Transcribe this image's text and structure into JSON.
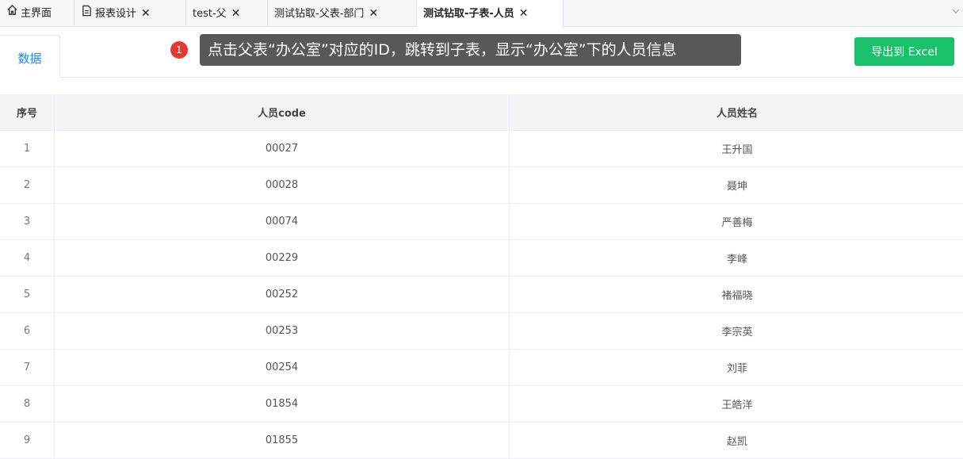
{
  "tabs": [
    {
      "label": "主界面",
      "closable": false,
      "icon": "home-icon"
    },
    {
      "label": "报表设计",
      "closable": true,
      "icon": "document-icon"
    },
    {
      "label": "test-父",
      "closable": true
    },
    {
      "label": "测试钻取-父表-部门",
      "closable": true
    },
    {
      "label": "测试钻取-子表-人员",
      "closable": true,
      "active": true
    }
  ],
  "close_glyph": "✕",
  "subtab": {
    "label": "数据"
  },
  "annotation": {
    "number": "1",
    "text": "点击父表“办公室”对应的ID，跳转到子表，显示“办公室”下的人员信息"
  },
  "toolbar": {
    "export_label": "导出到 Excel"
  },
  "table": {
    "headers": [
      "序号",
      "人员code",
      "人员姓名"
    ],
    "rows": [
      [
        "1",
        "00027",
        "王升国"
      ],
      [
        "2",
        "00028",
        "聂坤"
      ],
      [
        "3",
        "00074",
        "严善梅"
      ],
      [
        "4",
        "00229",
        "李峰"
      ],
      [
        "5",
        "00252",
        "褚福晓"
      ],
      [
        "6",
        "00253",
        "李宗英"
      ],
      [
        "7",
        "00254",
        "刘菲"
      ],
      [
        "8",
        "01854",
        "王皓洋"
      ],
      [
        "9",
        "01855",
        "赵凯"
      ]
    ]
  },
  "colors": {
    "accent": "#1e88e5",
    "export": "#19c26a",
    "badge": "#e53935",
    "tooltip_bg": "#585858"
  }
}
